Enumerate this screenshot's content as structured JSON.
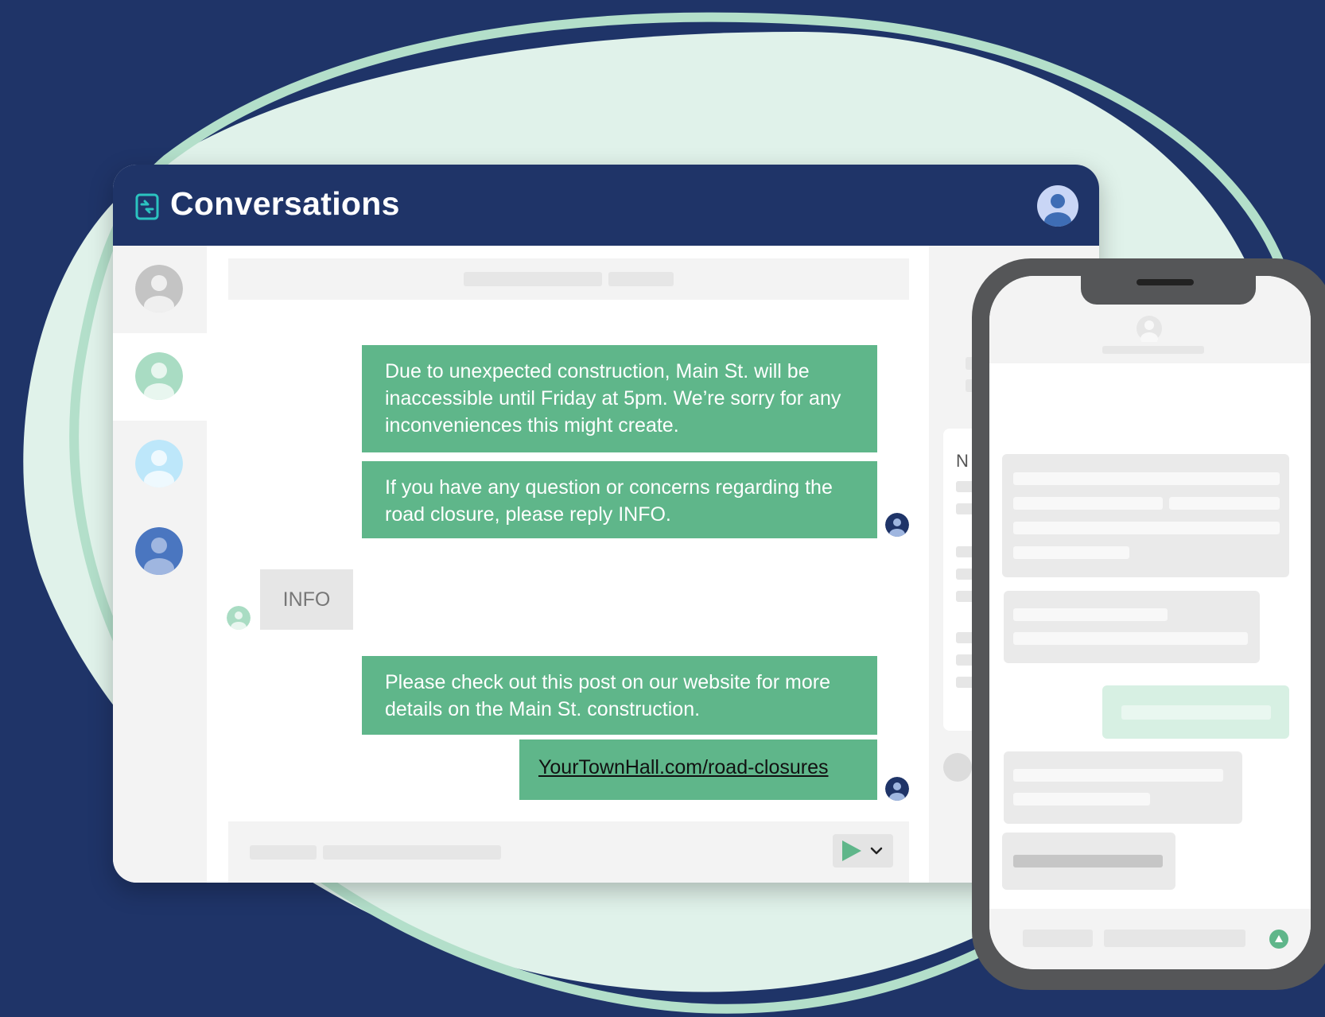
{
  "app": {
    "title": "Conversations"
  },
  "colors": {
    "navy": "#1f3468",
    "accent_green": "#5fb68a",
    "mint": "#e0f2ea"
  },
  "contacts": [
    {
      "avatar_color": "#c4c4c4"
    },
    {
      "avatar_color": "#a9dcc3"
    },
    {
      "avatar_color": "#bde7fa"
    },
    {
      "avatar_color": "#4a76c0"
    }
  ],
  "messages": [
    {
      "direction": "outgoing",
      "text": "Due to unexpected construction, Main St. will be inaccessible until Friday at 5pm. We’re sorry for any inconveniences this might create."
    },
    {
      "direction": "outgoing",
      "text": "If you have any question or concerns regarding the road closure, please reply INFO."
    },
    {
      "direction": "incoming",
      "text": "INFO"
    },
    {
      "direction": "outgoing",
      "text": "Please check out this post on our website for more details on the Main St. construction."
    },
    {
      "direction": "outgoing",
      "text": "YourTownHall.com/road-closures"
    }
  ],
  "right_panel": {
    "label": "N"
  }
}
